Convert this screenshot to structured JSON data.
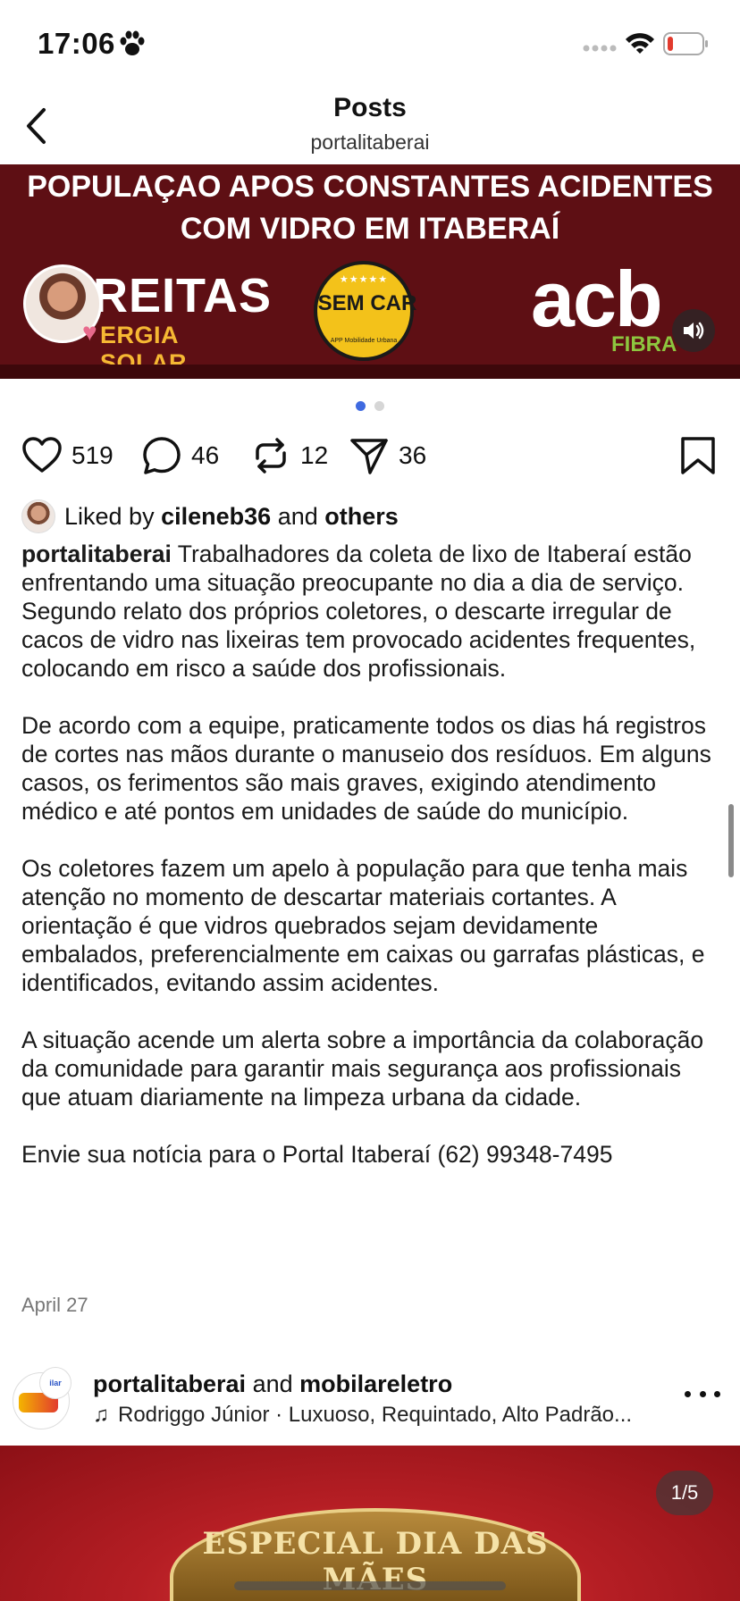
{
  "status": {
    "time": "17:06"
  },
  "header": {
    "title": "Posts",
    "subtitle": "portalitaberai"
  },
  "media": {
    "headline_line1": "POPULAÇAO APOS CONSTANTES ACIDENTES",
    "headline_line2": "COM VIDRO EM ITABERAÍ",
    "sponsors": {
      "freitas": "REITAS",
      "energia": "ERGIA SOLAR",
      "semcar": "SEM CAR",
      "semcar_sub": "APP Mobilidade Urbana",
      "acb": "acb",
      "fibra": "FIBRA"
    },
    "page_count": 2,
    "active_page": 1
  },
  "actions": {
    "likes": "519",
    "comments": "46",
    "reposts": "12",
    "shares": "36"
  },
  "liked_by": {
    "prefix": "Liked by",
    "user": "cileneb36",
    "middle": "and",
    "suffix": "others"
  },
  "caption": {
    "author": "portalitaberai",
    "p1": "Trabalhadores da coleta de lixo de Itaberaí estão enfrentando uma situação preocupante no dia a dia de serviço. Segundo relato dos próprios coletores, o descarte irregular de cacos de vidro nas lixeiras tem provocado acidentes frequentes, colocando em risco a saúde dos profissionais.",
    "p2": "De acordo com a equipe, praticamente todos os dias há registros de cortes nas mãos durante o manuseio dos resíduos. Em alguns casos, os ferimentos são mais graves, exigindo atendimento médico e até pontos em unidades de saúde do município.",
    "p3": "Os coletores fazem um apelo à população para que tenha mais atenção no momento de descartar materiais cortantes. A orientação é que vidros quebrados sejam devidamente embalados, preferencialmente em caixas ou garrafas plásticas, e identificados, evitando assim acidentes.",
    "p4": "A situação acende um alerta sobre a importância da colaboração da comunidade para garantir mais segurança aos profissionais que atuam diariamente na limpeza urbana da cidade.",
    "p5": "Envie sua notícia para o Portal Itaberaí (62) 99348-7495"
  },
  "post_date": "April 27",
  "next_post": {
    "author1": "portalitaberai",
    "conj": "and",
    "author2": "mobilareletro",
    "music": "Rodriggo Júnior · Luxuoso, Requintado, Alto Padrão...",
    "avatar2_text": "ilar",
    "media_text": "ESPECIAL DIA DAS MÃES",
    "page_badge": "1/5"
  }
}
